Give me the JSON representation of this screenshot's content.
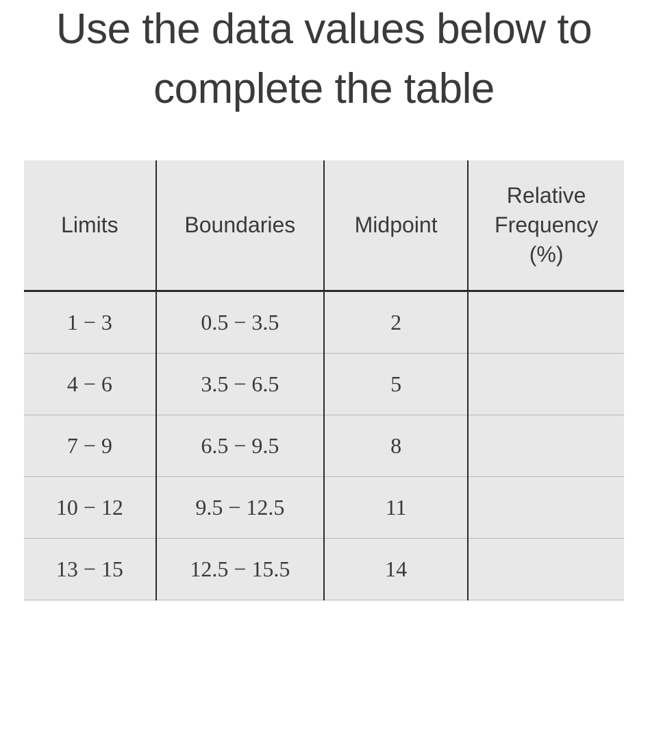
{
  "title": "Use the data values below to complete the table",
  "chart_data": {
    "type": "table",
    "columns": [
      "Limits",
      "Boundaries",
      "Midpoint",
      "Relative Frequency (%)"
    ],
    "rows": [
      {
        "limits": "1 − 3",
        "boundaries": "0.5 − 3.5",
        "midpoint": "2",
        "rel_freq": ""
      },
      {
        "limits": "4 − 6",
        "boundaries": "3.5 − 6.5",
        "midpoint": "5",
        "rel_freq": ""
      },
      {
        "limits": "7 − 9",
        "boundaries": "6.5 − 9.5",
        "midpoint": "8",
        "rel_freq": ""
      },
      {
        "limits": "10 − 12",
        "boundaries": "9.5 − 12.5",
        "midpoint": "11",
        "rel_freq": ""
      },
      {
        "limits": "13 − 15",
        "boundaries": "12.5 − 15.5",
        "midpoint": "14",
        "rel_freq": ""
      }
    ]
  }
}
